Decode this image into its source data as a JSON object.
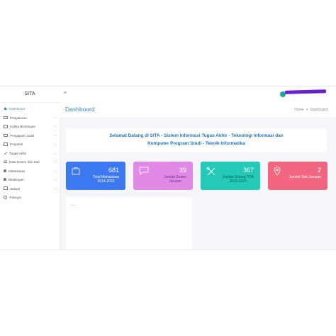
{
  "brand": "SITA",
  "sidebar": {
    "items": [
      {
        "label": "Dashboard",
        "icon": "home-icon",
        "active": true
      },
      {
        "label": "Pengaturan",
        "icon": "monitor-icon"
      },
      {
        "label": "Kebita Bimbingan",
        "icon": "monitor-icon"
      },
      {
        "label": "Pengajuan Judul",
        "icon": "monitor-icon"
      },
      {
        "label": "Proposal",
        "icon": "monitor-icon"
      },
      {
        "label": "Tugas Akhir",
        "icon": "pencil-icon"
      },
      {
        "label": "Data Dosen dan Staf",
        "icon": "list-icon"
      },
      {
        "label": "Mahasiswa",
        "icon": "user-icon"
      },
      {
        "label": "Bimbingan",
        "icon": "user-icon"
      },
      {
        "label": "Jadwal",
        "icon": "calendar-icon"
      },
      {
        "label": "Riwayat",
        "icon": "history-icon"
      }
    ]
  },
  "topbar": {
    "toggle_icon": "≡"
  },
  "header": {
    "title": "Dashboard",
    "breadcrumb": [
      "Home",
      "Dashboard"
    ]
  },
  "welcome": "Selamat Datang di SITA - Sistem Informasi Tugas Akhir - Teknologi Informasi dan Komputer Program Studi - Teknik Informatika",
  "cards": [
    {
      "value": "681",
      "label_1": "Total Mahasiswa",
      "label_2": "2014-2022",
      "color": "#3c78f0",
      "icon": "folder-icon"
    },
    {
      "value": "39",
      "label_1": "Jumlah Dosen",
      "label_2": "Jurusan",
      "color": "#e08ae6",
      "icon": "chat-icon"
    },
    {
      "value": "367",
      "label_1": "Jumlah Sidang TOA",
      "label_2": "2018-2022",
      "color": "#25c9b8",
      "icon": "tools-icon"
    },
    {
      "value": "2",
      "label_1": "Jumlah Staf Jurusan",
      "label_2": "",
      "color": "#f2677f",
      "icon": "location-icon"
    }
  ],
  "panel_text": "......"
}
